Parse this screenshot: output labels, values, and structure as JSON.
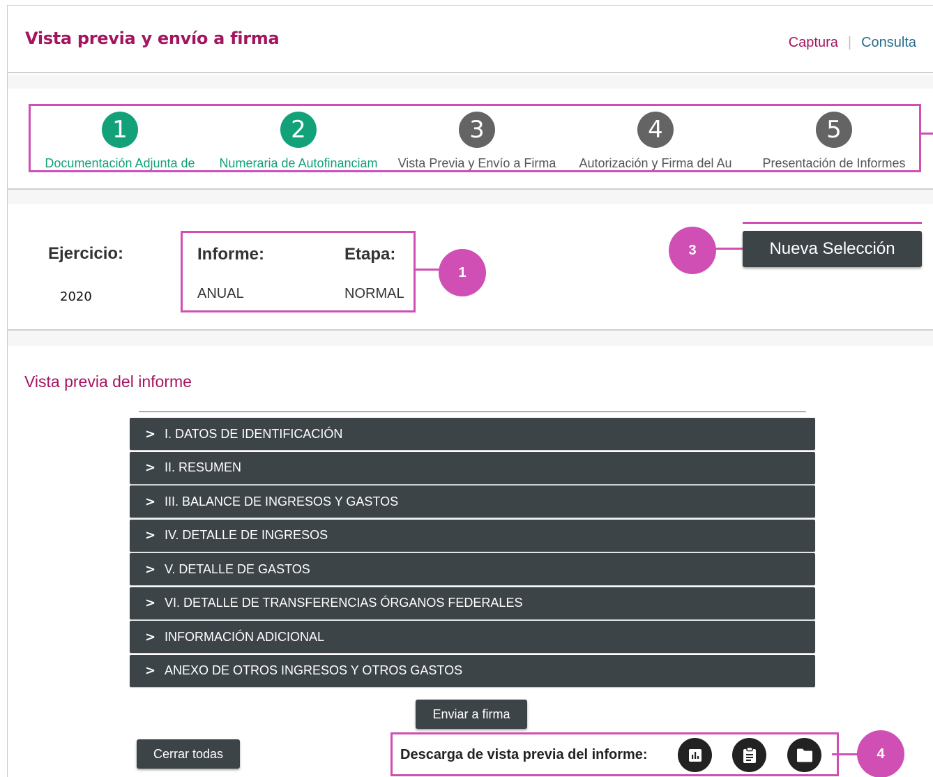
{
  "header": {
    "title": "Vista previa y envío a firma",
    "links": {
      "captura": "Captura",
      "separator": "|",
      "consulta": "Consulta"
    }
  },
  "stepper": {
    "steps": [
      {
        "number": "1",
        "label": "Documentación Adjunta de",
        "status": "complete"
      },
      {
        "number": "2",
        "label": "Numeraria de Autofinanciam",
        "status": "complete"
      },
      {
        "number": "3",
        "label": "Vista Previa y Envío a Firma",
        "status": "pending"
      },
      {
        "number": "4",
        "label": "Autorización y Firma del Au",
        "status": "pending"
      },
      {
        "number": "5",
        "label": "Presentación de Informes",
        "status": "pending"
      }
    ]
  },
  "selection": {
    "ejercicio_label": "Ejercicio:",
    "ejercicio_value": "2020",
    "informe_label": "Informe:",
    "informe_value": "ANUAL",
    "etapa_label": "Etapa:",
    "etapa_value": "NORMAL",
    "nueva_button": "Nueva Selección"
  },
  "callouts": {
    "c1": "1",
    "c3": "3",
    "c4": "4"
  },
  "preview": {
    "title": "Vista previa del informe",
    "sections": [
      "I. DATOS DE IDENTIFICACIÓN",
      "II. RESUMEN",
      "III. BALANCE DE INGRESOS Y GASTOS",
      "IV. DETALLE DE INGRESOS",
      "V. DETALLE DE GASTOS",
      "VI. DETALLE DE TRANSFERENCIAS ÓRGANOS FEDERALES",
      "INFORMACIÓN ADICIONAL",
      "ANEXO DE OTROS INGRESOS Y OTROS GASTOS"
    ],
    "chevron": ">",
    "enviar_button": "Enviar a firma",
    "cerrar_button": "Cerrar todas",
    "download_label": "Descarga de vista previa del informe:",
    "download_icons": [
      "bar-chart-icon",
      "clipboard-icon",
      "folder-icon"
    ]
  },
  "colors": {
    "brand": "#a3155f",
    "link": "#2a6d8d",
    "complete": "#13a17a",
    "pending": "#646464",
    "dark_button": "#3d4448",
    "annotation": "#cf4fb5"
  }
}
